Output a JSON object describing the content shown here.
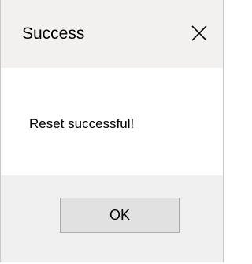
{
  "window": {
    "title": "Success",
    "close_icon": "close-icon"
  },
  "message": {
    "text": "Reset successful!"
  },
  "buttons": {
    "ok_label": "OK"
  }
}
